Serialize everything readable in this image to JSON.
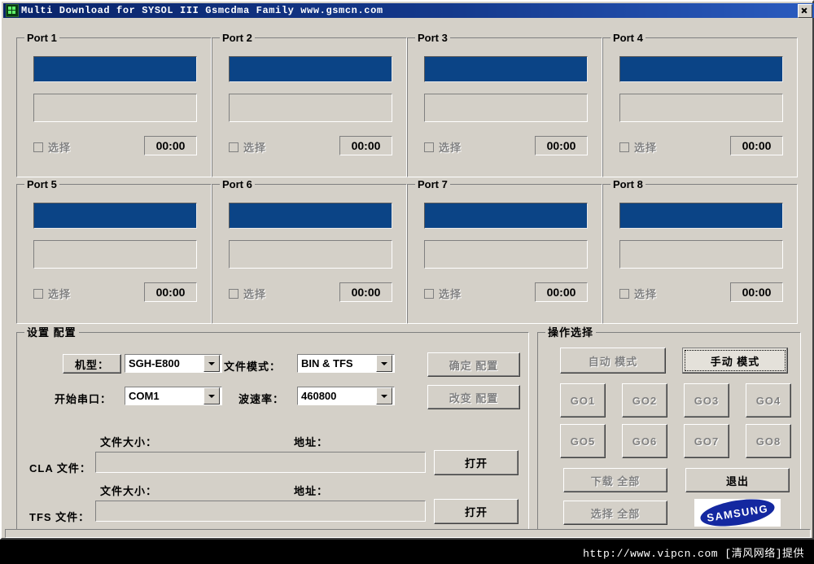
{
  "window": {
    "title": "Multi Download for SYSOL III Gsmcdma Family www.gsmcn.com",
    "close_label": "x",
    "icon": "app-icon"
  },
  "ports": [
    {
      "title": "Port 1",
      "status": "",
      "checkbox_label": "选择",
      "timer": "00:00"
    },
    {
      "title": "Port 2",
      "status": "",
      "checkbox_label": "选择",
      "timer": "00:00"
    },
    {
      "title": "Port 3",
      "status": "",
      "checkbox_label": "选择",
      "timer": "00:00"
    },
    {
      "title": "Port 4",
      "status": "",
      "checkbox_label": "选择",
      "timer": "00:00"
    },
    {
      "title": "Port 5",
      "status": "",
      "checkbox_label": "选择",
      "timer": "00:00"
    },
    {
      "title": "Port 6",
      "status": "",
      "checkbox_label": "选择",
      "timer": "00:00"
    },
    {
      "title": "Port 7",
      "status": "",
      "checkbox_label": "选择",
      "timer": "00:00"
    },
    {
      "title": "Port 8",
      "status": "",
      "checkbox_label": "选择",
      "timer": "00:00"
    }
  ],
  "settings": {
    "group_title": "设置 配置",
    "model_label": "机型：",
    "model_value": "SGH-E800",
    "filemode_label": "文件模式：",
    "filemode_value": "BIN & TFS",
    "startport_label": "开始串口：",
    "startport_value": "COM1",
    "baud_label": "波速率：",
    "baud_value": "460800",
    "confirm_config_label": "确定 配置",
    "change_config_label": "改变 配置",
    "cla": {
      "filesize_label": "文件大小：",
      "address_label": "地址：",
      "file_label": "CLA 文件：",
      "path_value": "",
      "open_label": "打开"
    },
    "tfs": {
      "filesize_label": "文件大小：",
      "address_label": "地址：",
      "file_label": "TFS 文件：",
      "path_value": "",
      "open_label": "打开"
    }
  },
  "operations": {
    "group_title": "操作选择",
    "auto_mode_label": "自动 模式",
    "manual_mode_label": "手动 模式",
    "go_buttons": [
      "GO1",
      "GO2",
      "GO3",
      "GO4",
      "GO5",
      "GO6",
      "GO7",
      "GO8"
    ],
    "download_all_label": "下载 全部",
    "exit_label": "退出",
    "select_all_label": "选择 全部",
    "brand_label": "SAMSUNG"
  },
  "watermark": {
    "text": "http://www.vipcn.com [清风网络]提供"
  },
  "colors": {
    "face": "#d4d0c8",
    "titlebar": "#0a246a",
    "port_bar_blue": "#0b4486",
    "samsung_blue": "#1428a0",
    "disabled_text": "#808080"
  }
}
